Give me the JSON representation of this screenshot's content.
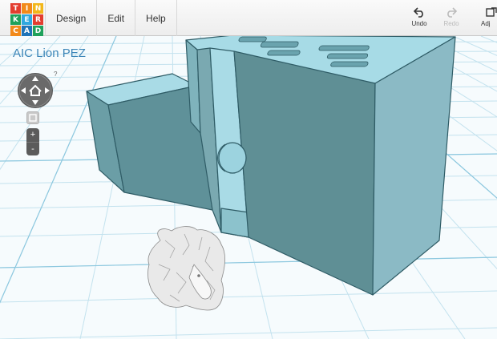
{
  "app": {
    "logo_letters": [
      "T",
      "I",
      "N",
      "K",
      "E",
      "R",
      "C",
      "A",
      "D"
    ],
    "logo_colors": [
      "#e33d2f",
      "#f28a1b",
      "#f2b71b",
      "#1fa15b",
      "#2fa8e0",
      "#e33d2f",
      "#f28a1b",
      "#1f74b8",
      "#1fa15b"
    ]
  },
  "menu": {
    "design": "Design",
    "edit": "Edit",
    "help": "Help"
  },
  "toolbar": {
    "undo": "Undo",
    "redo": "Redo",
    "adjust": "Adj"
  },
  "project": {
    "title": "AIC Lion PEZ"
  },
  "nav": {
    "help_glyph": "?",
    "zoom_in": "+",
    "zoom_out": "-"
  },
  "colors": {
    "grid_line": "#b9dcea",
    "grid_major": "#84c3dc",
    "shape_top": "#9cd3df",
    "shape_front": "#5f8f95",
    "shape_side": "#8bbac5",
    "lion": "#e8e8e8",
    "title": "#3d86b8"
  }
}
